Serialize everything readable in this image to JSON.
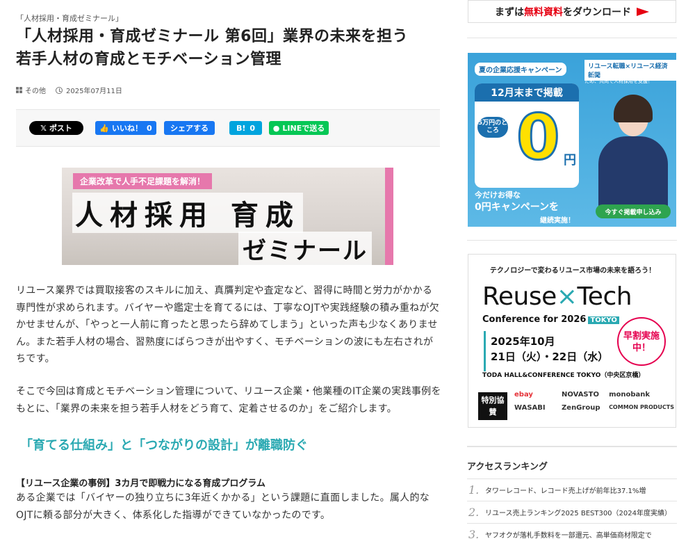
{
  "article": {
    "category_tag": "「人材採用・育成ゼミナール」",
    "title_line1": "「人材採用・育成ゼミナール 第6回」業界の未来を担う",
    "title_line2": "若手人材の育成とモチベーション管理",
    "meta": {
      "category": "その他",
      "date": "2025年07月11日"
    },
    "share": {
      "x_label": "ポスト",
      "like_label": "いいね！",
      "like_count": "0",
      "share_label": "シェアする",
      "hatena_label": "B!",
      "hatena_count": "0",
      "line_label": "LINEで送る"
    },
    "banner": {
      "sub": "企業改革で人手不足課題を解消！",
      "big": "人材採用 育成",
      "small": "ゼミナール"
    },
    "paragraph1": "リユース業界では買取接客のスキルに加え、真贋判定や査定など、習得に時間と労力がかかる専門性が求められます。バイヤーや鑑定士を育てるには、丁寧なOJTや実践経験の積み重ねが欠かせませんが、「やっと一人前に育ったと思ったら辞めてしまう」といった声も少なくありません。また若手人材の場合、習熟度にばらつきが出やすく、モチベーションの波にも左右されがちです。",
    "paragraph2": "そこで今回は育成とモチベーション管理について、リユース企業・他業種のIT企業の実践事例をもとに、「業界の未来を担う若手人材をどう育て、定着させるのか」をご紹介します。",
    "heading": "「育てる仕組み」と「つながりの設計」が離職防ぐ",
    "case_title": "【リユース企業の事例】3カ月で即戦力になる育成プログラム",
    "paragraph3": "ある企業では「バイヤーの独り立ちに3年近くかかる」という課題に直面しました。属人的なOJTに頼る部分が大きく、体系化した指導ができていなかったのです。"
  },
  "sidebar": {
    "cta": {
      "pre": "まずは",
      "red": "無料資料",
      "post": "をダウンロード"
    },
    "ad1": {
      "tagline": "夏の企業応援キャンペーン",
      "logo": "リユース転職×リユース経済新聞",
      "lead": "リユース業界の持続的な発展・成長のため、共同で人材採用を支援！",
      "card_head": "12月末まで掲載",
      "pill": "5万円のところ",
      "zero": "0",
      "yen": "円",
      "bottom1": "今だけお得な",
      "bottom2": "0円キャンペーンを",
      "bottom3": "継続実施！",
      "cta": "今すぐ掲載申し込み"
    },
    "ad2": {
      "head": "テクノロジーで変わるリユース市場の未来を語ろう！",
      "title_a": "Reuse",
      "title_x": "×",
      "title_b": "Tech",
      "conf": "Conference for 2026",
      "tokyo": "TOKYO",
      "date1": "2025年10月",
      "date2": "21日（火）・22日（水）",
      "early": "早割実施中！",
      "venue": "TODA HALL&CONFERENCE TOKYO（中央区京橋）",
      "sponsor": "特別協賛",
      "logos": [
        "ebay",
        "NOVASTO",
        "monobank",
        "WASABI",
        "ZenGroup",
        "COMMON PRODUCTS"
      ]
    },
    "ranking": {
      "heading": "アクセスランキング",
      "items": [
        {
          "num": "1.",
          "text": "タワーレコード、レコード売上げが前年比37.1%増"
        },
        {
          "num": "2.",
          "text": "リユース売上ランキング2025 BEST300（2024年度実績）"
        },
        {
          "num": "3.",
          "text": "ヤフオクが落札手数料を一部還元、高単価商材限定で"
        }
      ]
    }
  }
}
